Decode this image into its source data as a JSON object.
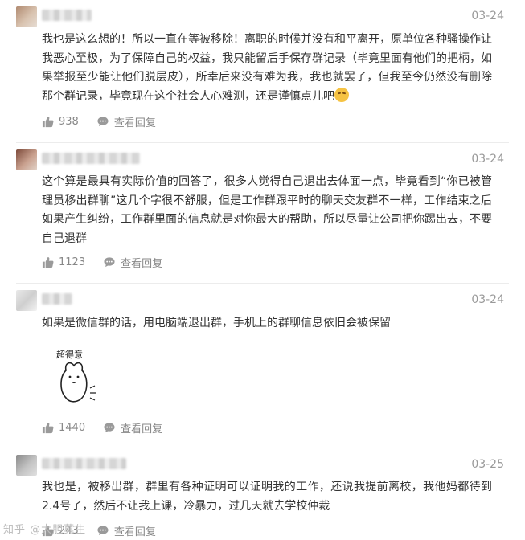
{
  "comments": [
    {
      "date": "03-24",
      "text": "我也是这么想的！所以一直在等被移除！离职的时候并没有和平离开，原单位各种骚操作让我恶心至极，为了保障自己的权益，我只能留后手保存群记录（毕竟里面有他们的把柄，如果举报至少能让他们脱层皮），所幸后来没有难为我，我也就罢了，但我至今仍然没有删除那个群记录，毕竟现在这个社会人心难测，还是谨慎点儿吧",
      "likes": "938",
      "reply_label": "查看回复"
    },
    {
      "date": "03-24",
      "text": "这个算是最具有实际价值的回答了，很多人觉得自己退出去体面一点，毕竟看到“你已被管理员移出群聊”这几个字很不舒服，但是工作群跟平时的聊天交友群不一样，工作结束之后如果产生纠纷，工作群里面的信息就是对你最大的帮助，所以尽量让公司把你踢出去，不要自己退群",
      "likes": "1123",
      "reply_label": "查看回复"
    },
    {
      "date": "03-24",
      "text": "如果是微信群的话，用电脑端退出群，手机上的群聊信息依旧会被保留",
      "sticker_text": "超得意",
      "likes": "1440",
      "reply_label": "查看回复"
    },
    {
      "date": "03-25",
      "text": "我也是，被移出群，群里有各种证明可以证明我的工作，还说我提前离校，我他妈都待到2.4号了，然后不让我上课，冷暴力，过几天就去学校仲裁",
      "likes": "243",
      "reply_label": "查看回复"
    }
  ],
  "watermark": "知乎 @大胆莫生",
  "icons": {
    "like": "thumbs-up-icon",
    "reply": "speech-bubble-icon",
    "emoji": "smug-face-emoji"
  },
  "colors": {
    "text": "#333333",
    "meta": "#999999",
    "divider": "#ececec"
  }
}
